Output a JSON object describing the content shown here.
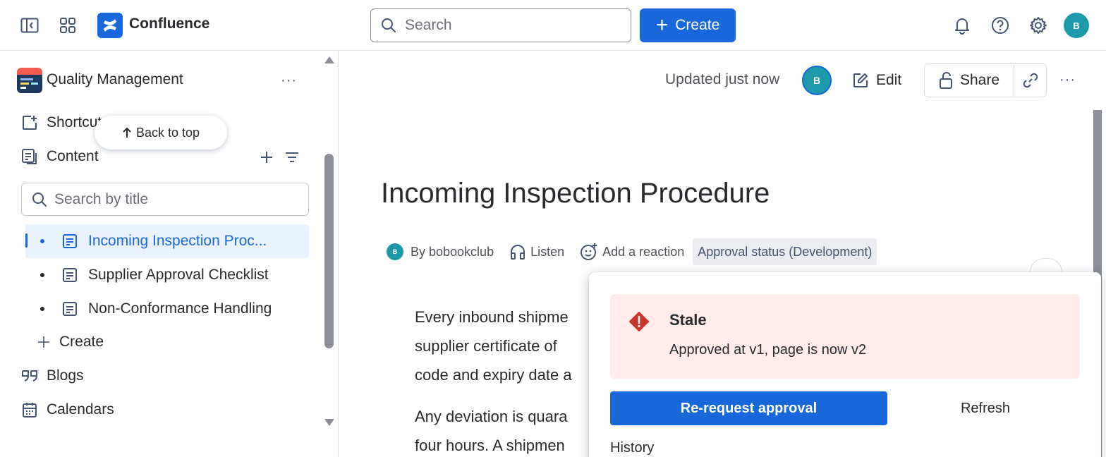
{
  "app": {
    "brand": "Confluence",
    "avatar_initial": "B",
    "accent": "#1868db"
  },
  "topbar": {
    "search_placeholder": "Search",
    "create_label": "Create",
    "icons": [
      "sidebar-toggle-icon",
      "app-switcher-icon",
      "confluence-logo-icon",
      "bell-icon",
      "help-icon",
      "gear-icon"
    ]
  },
  "sidebar": {
    "space_name": "Quality Management",
    "more_label": "···",
    "shortcuts_label": "Shortcuts",
    "back_to_top": "Back to top",
    "content_label": "Content",
    "tree_search_placeholder": "Search by title",
    "tree": [
      {
        "label": "Incoming Inspection Proc...",
        "selected": true
      },
      {
        "label": "Supplier Approval Checklist",
        "selected": false
      },
      {
        "label": "Non-Conformance Handling",
        "selected": false
      }
    ],
    "create_label": "Create",
    "blogs_label": "Blogs",
    "calendars_label": "Calendars"
  },
  "page": {
    "updated": "Updated just now",
    "author_initial": "B",
    "edit_label": "Edit",
    "share_label": "Share",
    "more_label": "···",
    "title": "Incoming Inspection Procedure",
    "byline": {
      "author_initial": "B",
      "author": "By bobookclub",
      "listen": "Listen",
      "reaction": "Add a reaction",
      "status": "Approval status (Development)"
    },
    "body_lines": [
      "Every inbound shipme",
      "supplier certificate of",
      "code and expiry date a",
      "Any deviation is quara",
      "four hours. A shipmen"
    ]
  },
  "approval_popup": {
    "status_title": "Stale",
    "status_message": "Approved at v1, page is now v2",
    "status_color": "#c9372c",
    "rerequest_label": "Re-request approval",
    "refresh_label": "Refresh",
    "history_label": "History"
  }
}
